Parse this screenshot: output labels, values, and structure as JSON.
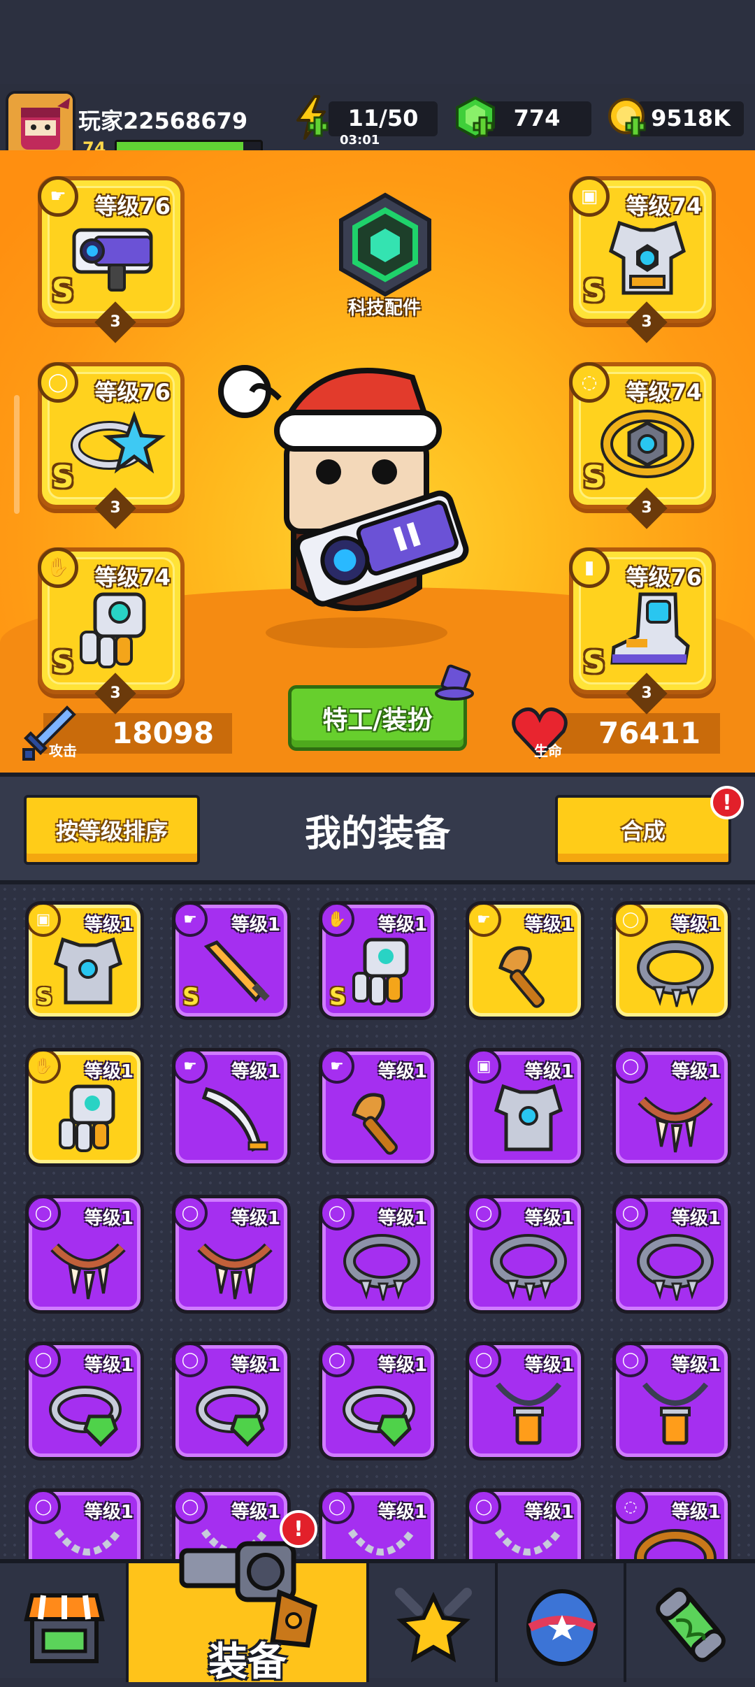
{
  "player": {
    "name": "玩家22568679",
    "level": "74",
    "xp_fraction": 0.88
  },
  "resources": {
    "energy": {
      "value": "11/50",
      "timer": "03:01",
      "icon": "lightning-icon"
    },
    "gems": {
      "value": "774",
      "icon": "green-gem-icon"
    },
    "coins": {
      "value": "9518K",
      "icon": "gold-coin-icon"
    }
  },
  "equipped": {
    "left": [
      {
        "slot": "weapon",
        "level": "等级76",
        "rank": "S",
        "stars": "3",
        "icon": "blaster-icon"
      },
      {
        "slot": "ring",
        "level": "等级76",
        "rank": "S",
        "stars": "3",
        "icon": "star-ring-icon"
      },
      {
        "slot": "gloves",
        "level": "等级74",
        "rank": "S",
        "stars": "3",
        "icon": "gauntlet-icon"
      }
    ],
    "right": [
      {
        "slot": "armor",
        "level": "等级74",
        "rank": "S",
        "stars": "3",
        "icon": "armor-icon"
      },
      {
        "slot": "belt",
        "level": "等级74",
        "rank": "S",
        "stars": "3",
        "icon": "belt-icon"
      },
      {
        "slot": "boots",
        "level": "等级76",
        "rank": "S",
        "stars": "3",
        "icon": "boot-icon"
      }
    ]
  },
  "tech_label": "科技配件",
  "agent_button": "特工/装扮",
  "stats": {
    "attack_label": "攻击",
    "attack": "18098",
    "hp_label": "生命",
    "hp": "76411"
  },
  "inventory": {
    "sort_button": "按等级排序",
    "title": "我的装备",
    "merge_button": "合成",
    "alert": "!",
    "items": [
      {
        "level": "等级1",
        "rarity": "gold",
        "rank": "S",
        "icon": "armor-icon"
      },
      {
        "level": "等级1",
        "rarity": "purple",
        "rank": "S",
        "icon": "sword-icon"
      },
      {
        "level": "等级1",
        "rarity": "purple",
        "rank": "S",
        "icon": "gauntlet-icon"
      },
      {
        "level": "等级1",
        "rarity": "gold",
        "rank": "",
        "icon": "club-icon"
      },
      {
        "level": "等级1",
        "rarity": "gold",
        "rank": "",
        "icon": "spiked-collar-icon"
      },
      {
        "level": "等级1",
        "rarity": "gold",
        "rank": "",
        "icon": "gauntlet-icon"
      },
      {
        "level": "等级1",
        "rarity": "purple",
        "rank": "",
        "icon": "scimitar-icon"
      },
      {
        "level": "等级1",
        "rarity": "purple",
        "rank": "",
        "icon": "club-icon"
      },
      {
        "level": "等级1",
        "rarity": "purple",
        "rank": "",
        "icon": "armor-icon"
      },
      {
        "level": "等级1",
        "rarity": "purple",
        "rank": "",
        "icon": "fang-necklace-icon"
      },
      {
        "level": "等级1",
        "rarity": "purple",
        "rank": "",
        "icon": "fang-necklace-icon"
      },
      {
        "level": "等级1",
        "rarity": "purple",
        "rank": "",
        "icon": "fang-necklace-icon"
      },
      {
        "level": "等级1",
        "rarity": "purple",
        "rank": "",
        "icon": "spiked-collar-icon"
      },
      {
        "level": "等级1",
        "rarity": "purple",
        "rank": "",
        "icon": "spiked-collar-icon"
      },
      {
        "level": "等级1",
        "rarity": "purple",
        "rank": "",
        "icon": "spiked-collar-icon"
      },
      {
        "level": "等级1",
        "rarity": "purple",
        "rank": "",
        "icon": "gem-ring-icon"
      },
      {
        "level": "等级1",
        "rarity": "purple",
        "rank": "",
        "icon": "gem-ring-icon"
      },
      {
        "level": "等级1",
        "rarity": "purple",
        "rank": "",
        "icon": "gem-ring-icon"
      },
      {
        "level": "等级1",
        "rarity": "purple",
        "rank": "",
        "icon": "lantern-necklace-icon"
      },
      {
        "level": "等级1",
        "rarity": "purple",
        "rank": "",
        "icon": "lantern-necklace-icon"
      },
      {
        "level": "等级1",
        "rarity": "purple",
        "rank": "",
        "icon": "chain-necklace-icon"
      },
      {
        "level": "等级1",
        "rarity": "purple",
        "rank": "",
        "icon": "chain-necklace-icon"
      },
      {
        "level": "等级1",
        "rarity": "purple",
        "rank": "",
        "icon": "chain-necklace-icon"
      },
      {
        "level": "等级1",
        "rarity": "purple",
        "rank": "",
        "icon": "chain-necklace-icon"
      },
      {
        "level": "等级1",
        "rarity": "purple",
        "rank": "",
        "icon": "belt-icon"
      }
    ]
  },
  "nav": {
    "tabs": [
      {
        "id": "shop",
        "icon": "shop-icon",
        "label": ""
      },
      {
        "id": "equipment",
        "icon": "revolver-icon",
        "label": "装备",
        "active": true,
        "alert": "!"
      },
      {
        "id": "talent",
        "icon": "star-swords-icon",
        "label": ""
      },
      {
        "id": "gacha",
        "icon": "star-egg-icon",
        "label": ""
      },
      {
        "id": "evolve",
        "icon": "dna-capsule-icon",
        "label": ""
      }
    ]
  },
  "colors": {
    "hero_bg": "#ffb81c",
    "purple_rarity": "#a52ff0",
    "gold_rarity": "#ffd11a",
    "nav_active": "#ffc31a",
    "agent_button": "#67cf2d"
  }
}
